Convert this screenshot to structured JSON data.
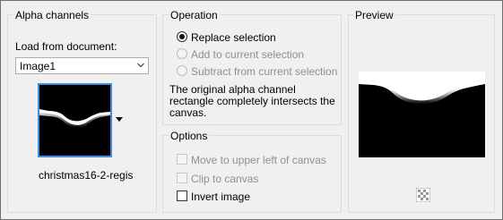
{
  "alpha": {
    "title": "Alpha channels",
    "load_label": "Load from document:",
    "document_value": "Image1",
    "channel_name": "christmas16-2-regis"
  },
  "operation": {
    "title": "Operation",
    "replace": "Replace selection",
    "add": "Add to current selection",
    "subtract": "Subtract from current selection",
    "message": "The original alpha channel rectangle completely intersects the canvas."
  },
  "options": {
    "title": "Options",
    "move": "Move to upper left of canvas",
    "clip": "Clip to canvas",
    "invert": "Invert image"
  },
  "preview": {
    "title": "Preview"
  },
  "icons": {
    "dropdown": "chevron-down-icon",
    "transparency": "checkerboard-icon"
  },
  "colors": {
    "selection_border": "#3b8fe0",
    "disabled_text": "#8f8f8f"
  }
}
